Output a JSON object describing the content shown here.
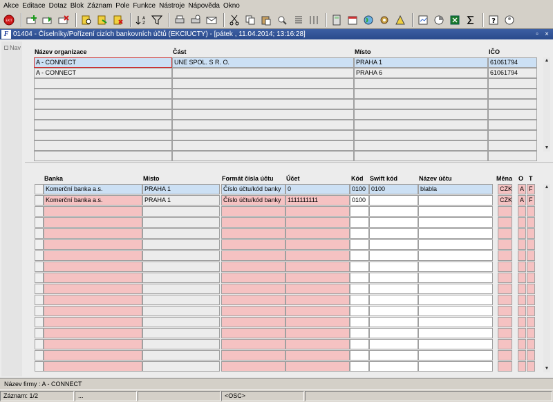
{
  "menu": [
    "Akce",
    "Editace",
    "Dotaz",
    "Blok",
    "Záznam",
    "Pole",
    "Funkce",
    "Nástroje",
    "Nápověda",
    "Okno"
  ],
  "toolbar_icons": [
    "exit-icon",
    "insert-record-icon",
    "save-icon",
    "delete-record-icon",
    "query-enter-icon",
    "query-execute-icon",
    "query-cancel-icon",
    "sort-icon",
    "filter-icon",
    "print-icon",
    "print-setup-icon",
    "mail-icon",
    "cut-icon",
    "copy-icon",
    "paste-icon",
    "zoom-icon",
    "list-icon",
    "columns-icon",
    "calculator-icon",
    "calendar-icon",
    "globe-icon",
    "settings-icon",
    "warning-icon",
    "report-icon",
    "chart-icon",
    "excel-icon",
    "sum-icon",
    "help-icon",
    "about-icon"
  ],
  "window": {
    "title": "01404 - Číselníky/Pořízení cizích bankovních účtů (EKCIUCTY) - [pátek , 11.04.2014; 13:16:28]",
    "icon_letter": "F",
    "restore": "▫",
    "close": "×"
  },
  "nav": {
    "label": "Nav"
  },
  "upper": {
    "headers": {
      "name": "Název organizace",
      "part": "Část",
      "place": "Místo",
      "ico": "IČO"
    },
    "rows": [
      {
        "name": "A - CONNECT",
        "part": "UNE SPOL. S R. O.",
        "place": "PRAHA 1",
        "ico": "61061794"
      },
      {
        "name": "A - CONNECT",
        "part": "",
        "place": "PRAHA 6",
        "ico": "61061794"
      }
    ]
  },
  "lower": {
    "headers": {
      "bank": "Banka",
      "place": "Místo",
      "fmt": "Formát čísla účtu",
      "acc": "Účet",
      "code": "Kód",
      "swift": "Swift kód",
      "accname": "Název účtu",
      "cur": "Měna",
      "o": "O",
      "t": "T"
    },
    "rows": [
      {
        "bank": "Komerční banka a.s.",
        "place": "PRAHA 1",
        "fmt": "Číslo účtu/kód banky",
        "acc": "0",
        "code": "0100",
        "swift": "0100",
        "accname": "blabla",
        "cur": "CZK",
        "o": "A",
        "t": "F"
      },
      {
        "bank": "Komerční banka a.s.",
        "place": "PRAHA 1",
        "fmt": "Číslo účtu/kód banky",
        "acc": "1111111111",
        "code": "0100",
        "swift": "",
        "accname": "",
        "cur": "CZK",
        "o": "A",
        "t": "F"
      }
    ]
  },
  "status": {
    "line1": "Název firmy : A - CONNECT",
    "record": "Záznam: 1/2",
    "s2": "...",
    "s3": "",
    "osc": "<OSC>"
  },
  "colors": {
    "title_bg": "#2a4a8c",
    "selected_row": "#cce0f4",
    "required_field": "#f5c2c2"
  }
}
